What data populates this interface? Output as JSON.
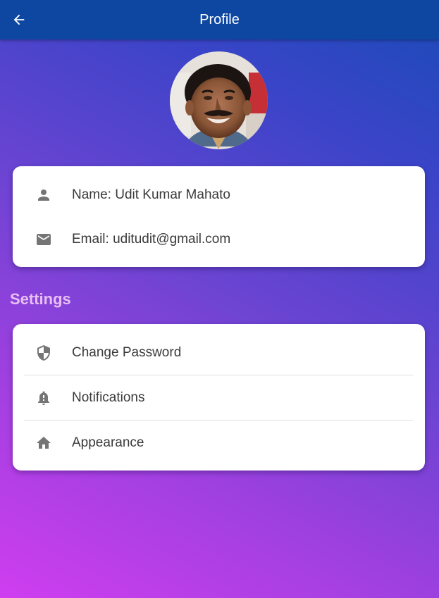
{
  "app_bar": {
    "title": "Profile",
    "back_icon": "arrow-back-icon",
    "color": "#0d47a1"
  },
  "profile": {
    "avatar_icon": "profile-photo",
    "name": "Name: Udit Kumar Mahato",
    "name_icon": "person-icon",
    "email": "Email: uditudit@gmail.com",
    "email_icon": "mail-icon"
  },
  "settings": {
    "title": "Settings",
    "items": [
      {
        "label": "Change Password",
        "icon": "shield-icon"
      },
      {
        "label": "Notifications",
        "icon": "bell-alert-icon"
      },
      {
        "label": "Appearance",
        "icon": "home-icon"
      }
    ]
  },
  "colors": {
    "gradient_top": "#1a4bb8",
    "gradient_bottom": "#cf3ef0",
    "section_title": "#e8bff3",
    "icon": "#757575"
  }
}
